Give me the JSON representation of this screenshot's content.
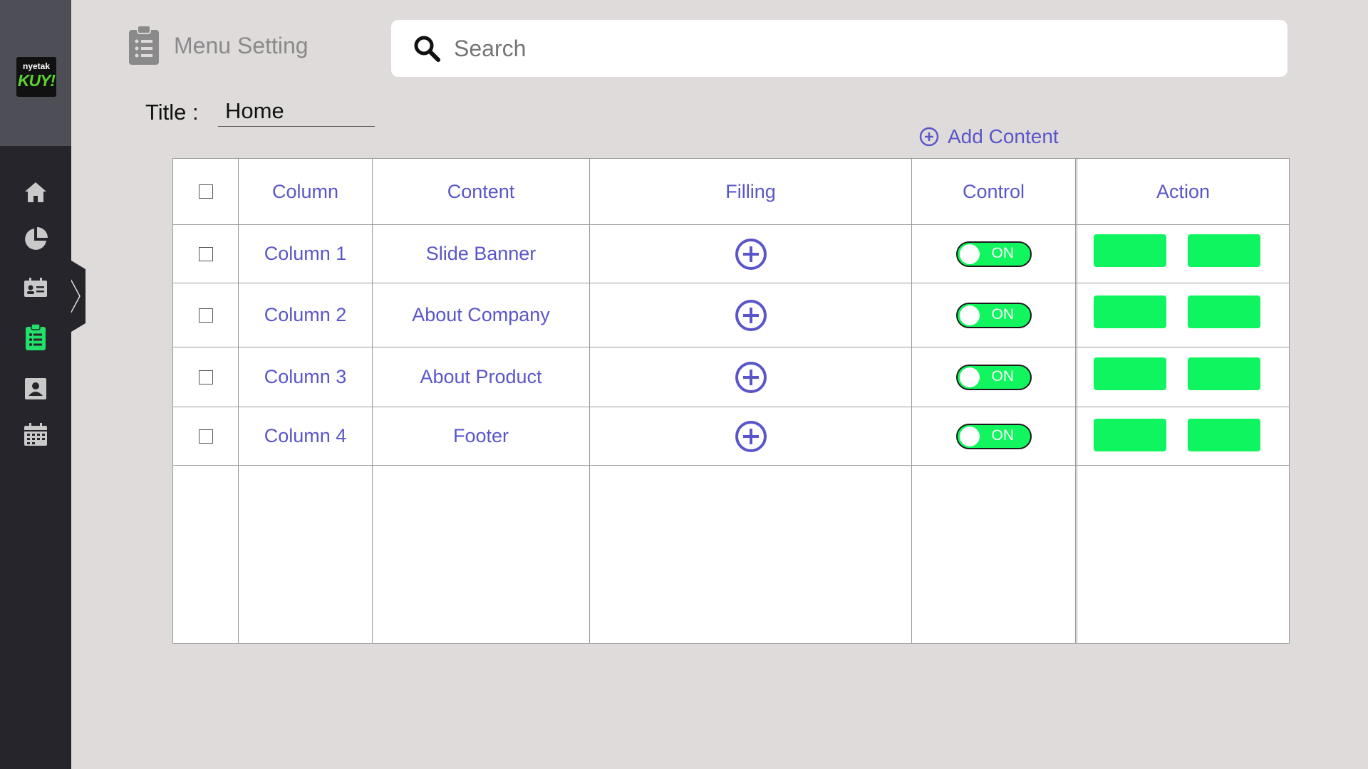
{
  "sidebar": {
    "logo_text": [
      "nyetak",
      "KUY!"
    ],
    "items": [
      {
        "icon": "home-icon",
        "active": false
      },
      {
        "icon": "pie-chart-icon",
        "active": false
      },
      {
        "icon": "id-card-icon",
        "active": false
      },
      {
        "icon": "clipboard-list-icon",
        "active": true
      },
      {
        "icon": "user-card-icon",
        "active": false
      },
      {
        "icon": "calendar-icon",
        "active": false
      }
    ]
  },
  "header": {
    "title": "Menu Setting",
    "title_icon": "clipboard-list-icon"
  },
  "search": {
    "placeholder": "Search"
  },
  "form": {
    "title_label": "Title :",
    "title_value": "Home",
    "add_content_label": "Add Content"
  },
  "table": {
    "headers": [
      "Column",
      "Content",
      "Filling",
      "Control",
      "Action"
    ],
    "rows": [
      {
        "column": "Column 1",
        "content": "Slide Banner",
        "control": "ON"
      },
      {
        "column": "Column 2",
        "content": "About Company",
        "control": "ON"
      },
      {
        "column": "Column 3",
        "content": "About Product",
        "control": "ON"
      },
      {
        "column": "Column 4",
        "content": "Footer",
        "control": "ON"
      }
    ]
  },
  "colors": {
    "accent": "#5a56c9",
    "toggle_on": "#11f55e",
    "action_button": "#0ff55f",
    "sidebar_active": "#22e06a",
    "sidebar_icon": "#c9c9c9"
  }
}
